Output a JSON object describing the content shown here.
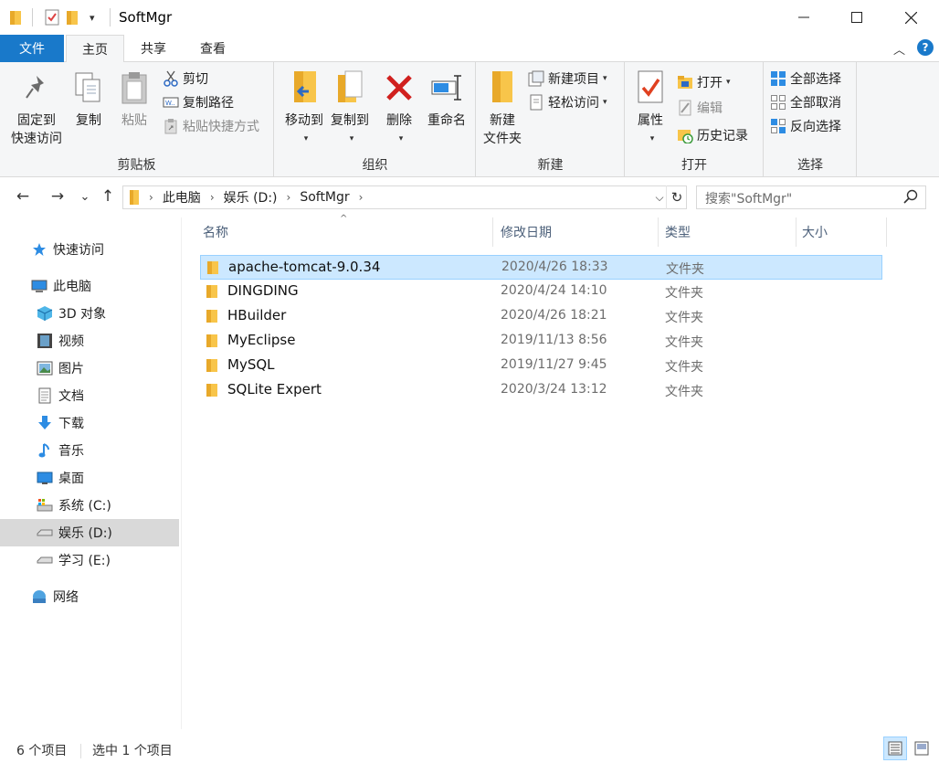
{
  "window": {
    "title": "SoftMgr",
    "controls": {
      "minimize": "—",
      "maximize": "☐",
      "close": "✕"
    }
  },
  "quick_access": {
    "dropdown": "▾"
  },
  "ribbon_tabs": [
    {
      "label": "文件"
    },
    {
      "label": "主页"
    },
    {
      "label": "共享"
    },
    {
      "label": "查看"
    }
  ],
  "help": {
    "collapse": "︿",
    "help": "?"
  },
  "ribbon": {
    "clipboard": {
      "label": "剪贴板",
      "pin_line1": "固定到",
      "pin_line2": "快速访问",
      "copy": "复制",
      "paste": "粘贴",
      "cut": "剪切",
      "copy_path": "复制路径",
      "paste_shortcut": "粘贴快捷方式"
    },
    "organize": {
      "label": "组织",
      "move_to": "移动到",
      "copy_to": "复制到",
      "delete": "删除",
      "rename": "重命名"
    },
    "new": {
      "label": "新建",
      "new_folder_line1": "新建",
      "new_folder_line2": "文件夹",
      "new_item": "新建项目",
      "easy_access": "轻松访问"
    },
    "open": {
      "label": "打开",
      "properties": "属性",
      "open": "打开",
      "edit": "编辑",
      "history": "历史记录"
    },
    "select": {
      "label": "选择",
      "select_all": "全部选择",
      "select_none": "全部取消",
      "invert": "反向选择"
    }
  },
  "address": {
    "crumbs": [
      "此电脑",
      "娱乐 (D:)",
      "SoftMgr"
    ],
    "separator": "›",
    "dropdown": "⌵",
    "refresh": "↻"
  },
  "search": {
    "placeholder": "搜索\"SoftMgr\""
  },
  "nav": {
    "back": "←",
    "forward": "→",
    "recent": "⌄",
    "up": "↑"
  },
  "nav_pane": [
    {
      "label": "快速访问",
      "icon": "star-icon"
    },
    {
      "label": "此电脑",
      "icon": "pc-icon"
    },
    {
      "label": "3D 对象",
      "icon": "cube-icon"
    },
    {
      "label": "视频",
      "icon": "film-icon"
    },
    {
      "label": "图片",
      "icon": "picture-icon"
    },
    {
      "label": "文档",
      "icon": "document-icon"
    },
    {
      "label": "下载",
      "icon": "download-icon"
    },
    {
      "label": "音乐",
      "icon": "music-icon"
    },
    {
      "label": "桌面",
      "icon": "desktop-icon"
    },
    {
      "label": "系统 (C:)",
      "icon": "drive-icon"
    },
    {
      "label": "娱乐 (D:)",
      "icon": "drive-icon"
    },
    {
      "label": "学习 (E:)",
      "icon": "drive-icon"
    },
    {
      "label": "网络",
      "icon": "network-icon"
    }
  ],
  "columns": {
    "name": "名称",
    "date": "修改日期",
    "type": "类型",
    "size": "大小",
    "sort_arrow": "^"
  },
  "files": [
    {
      "name": "apache-tomcat-9.0.34",
      "date": "2020/4/26 18:33",
      "type": "文件夹"
    },
    {
      "name": "DINGDING",
      "date": "2020/4/24 14:10",
      "type": "文件夹"
    },
    {
      "name": "HBuilder",
      "date": "2020/4/26 18:21",
      "type": "文件夹"
    },
    {
      "name": "MyEclipse",
      "date": "2019/11/13 8:56",
      "type": "文件夹"
    },
    {
      "name": "MySQL",
      "date": "2019/11/27 9:45",
      "type": "文件夹"
    },
    {
      "name": "SQLite Expert",
      "date": "2020/3/24 13:12",
      "type": "文件夹"
    }
  ],
  "status": {
    "item_count": "6 个项目",
    "selected": "选中 1 个项目"
  },
  "colors": {
    "accent": "#1979ca",
    "selection": "#cce8ff",
    "selection_border": "#99d1ff",
    "folder": "#f8c54a"
  }
}
